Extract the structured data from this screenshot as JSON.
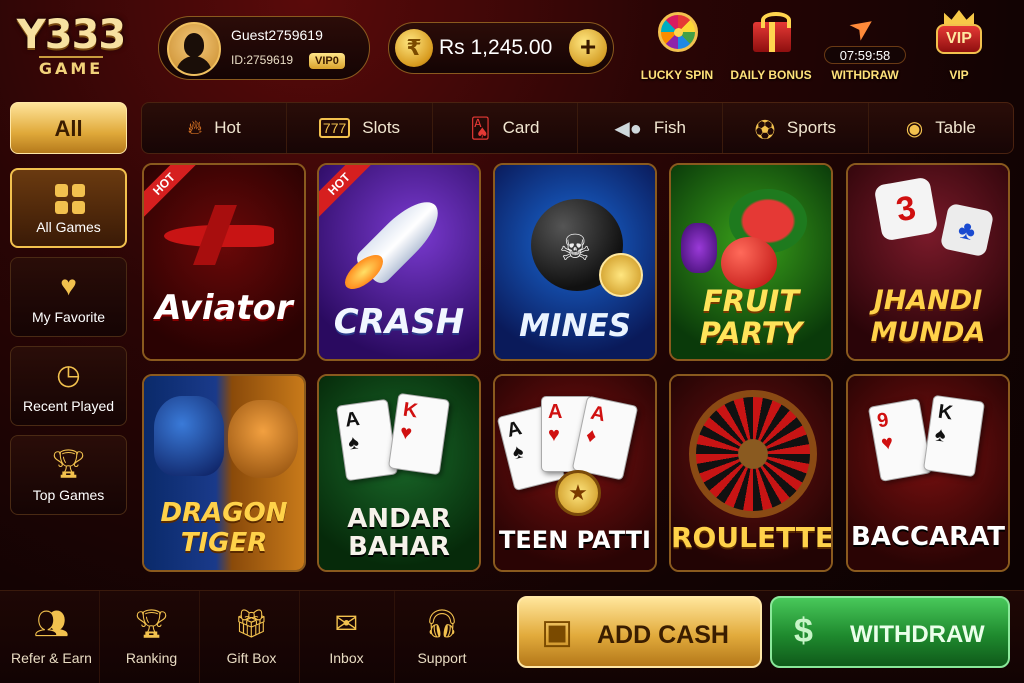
{
  "brand": {
    "logo_main": "Y333",
    "logo_sub": "GAME"
  },
  "profile": {
    "name": "Guest2759619",
    "id_text": "ID:2759619",
    "vip_level": "VIP0"
  },
  "balance": {
    "currency_symbol": "₹",
    "amount": "Rs 1,245.00",
    "add_symbol": "+"
  },
  "top_actions": {
    "lucky_spin": "LUCKY SPIN",
    "daily_bonus": "DAILY BONUS",
    "withdraw_timer": "07:59:58",
    "withdraw": "WITHDRAW",
    "vip_badge": "VIP",
    "vip": "VIP"
  },
  "categories": {
    "all": "All",
    "tabs": [
      {
        "label": "Hot",
        "icon": "flame-icon"
      },
      {
        "label": "Slots",
        "icon": "slot-machine-icon"
      },
      {
        "label": "Card",
        "icon": "playing-cards-icon"
      },
      {
        "label": "Fish",
        "icon": "fish-icon"
      },
      {
        "label": "Sports",
        "icon": "ball-icon"
      },
      {
        "label": "Table",
        "icon": "chip-icon"
      }
    ]
  },
  "sidebar": {
    "items": [
      {
        "label": "All Games",
        "icon": "grid-icon"
      },
      {
        "label": "My Favorite",
        "icon": "heart-icon"
      },
      {
        "label": "Recent Played",
        "icon": "clock-icon"
      },
      {
        "label": "Top Games",
        "icon": "trophy-icon"
      }
    ]
  },
  "games": [
    {
      "name": "Aviator",
      "badge": "HOT"
    },
    {
      "name": "CRASH",
      "badge": "HOT"
    },
    {
      "name": "MINES"
    },
    {
      "name_line1": "FRUIT",
      "name_line2": "PARTY"
    },
    {
      "name_line1": "JHANDI",
      "name_line2": "MUNDA"
    },
    {
      "name_line1": "DRAGON",
      "name_line2": "TIGER"
    },
    {
      "name_line1": "ANDAR",
      "name_line2": "BAHAR"
    },
    {
      "name": "TEEN PATTI"
    },
    {
      "name": "ROULETTE"
    },
    {
      "name": "BACCARAT"
    }
  ],
  "bottom_nav": [
    {
      "label": "Refer & Earn",
      "icon": "users-icon"
    },
    {
      "label": "Ranking",
      "icon": "trophy-icon"
    },
    {
      "label": "Gift Box",
      "icon": "gift-icon"
    },
    {
      "label": "Inbox",
      "icon": "envelope-icon"
    },
    {
      "label": "Support",
      "icon": "headset-icon"
    }
  ],
  "buttons": {
    "add_cash": "ADD CASH",
    "withdraw": "WITHDRAW"
  },
  "colors": {
    "accent_gold": "#f2c14e",
    "withdraw_green": "#1f8a2e",
    "hot_red": "#d61f1f"
  }
}
